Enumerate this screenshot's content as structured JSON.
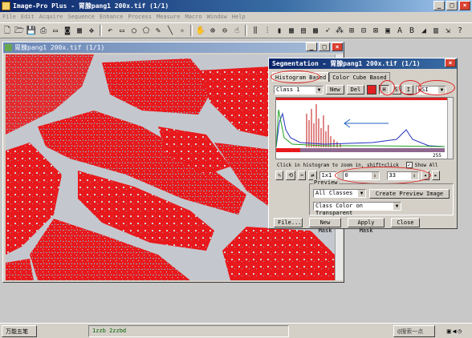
{
  "app": {
    "title": "Image-Pro Plus - 胃腺pang1  200x.tif (1/1)"
  },
  "menu": [
    "File",
    "Edit",
    "Acquire",
    "Sequence",
    "Enhance",
    "Process",
    "Measure",
    "Macro",
    "Window",
    "Help"
  ],
  "image_window": {
    "title": "胃腺pang1  200x.tif (1/1)"
  },
  "segmentation": {
    "title": "Segmentation - 胃腺pang1  200x.tif (1/1)",
    "tabs": [
      "Histogram Based",
      "Color Cube Based"
    ],
    "class_select": "Class 1",
    "new_label": "New",
    "del_label": "Del",
    "channel_buttons": [
      "H",
      "S",
      "I"
    ],
    "color_model": "HSI",
    "histo_max": "255",
    "hint": "Click in histogram to zoom in, shift+click",
    "show_all_label": "Show All",
    "zoom_select": "1x1",
    "range_min": "0",
    "range_max": "33",
    "preview_label": "Preview",
    "classes_select": "All Classes",
    "create_preview": "Create Preview Image",
    "color_mode": "Class Color on Transparent",
    "file_btn": "File...",
    "newmask_btn": "New Mask",
    "applymask_btn": "Apply Mask",
    "close_btn": "Close"
  },
  "taskbar": {
    "start_item": "万能五笔",
    "status": "1zzb 2zzbd",
    "right_item": "@搜索一点"
  },
  "colors": {
    "segmented": "#e8191c",
    "titlebar": "#0a246a"
  }
}
